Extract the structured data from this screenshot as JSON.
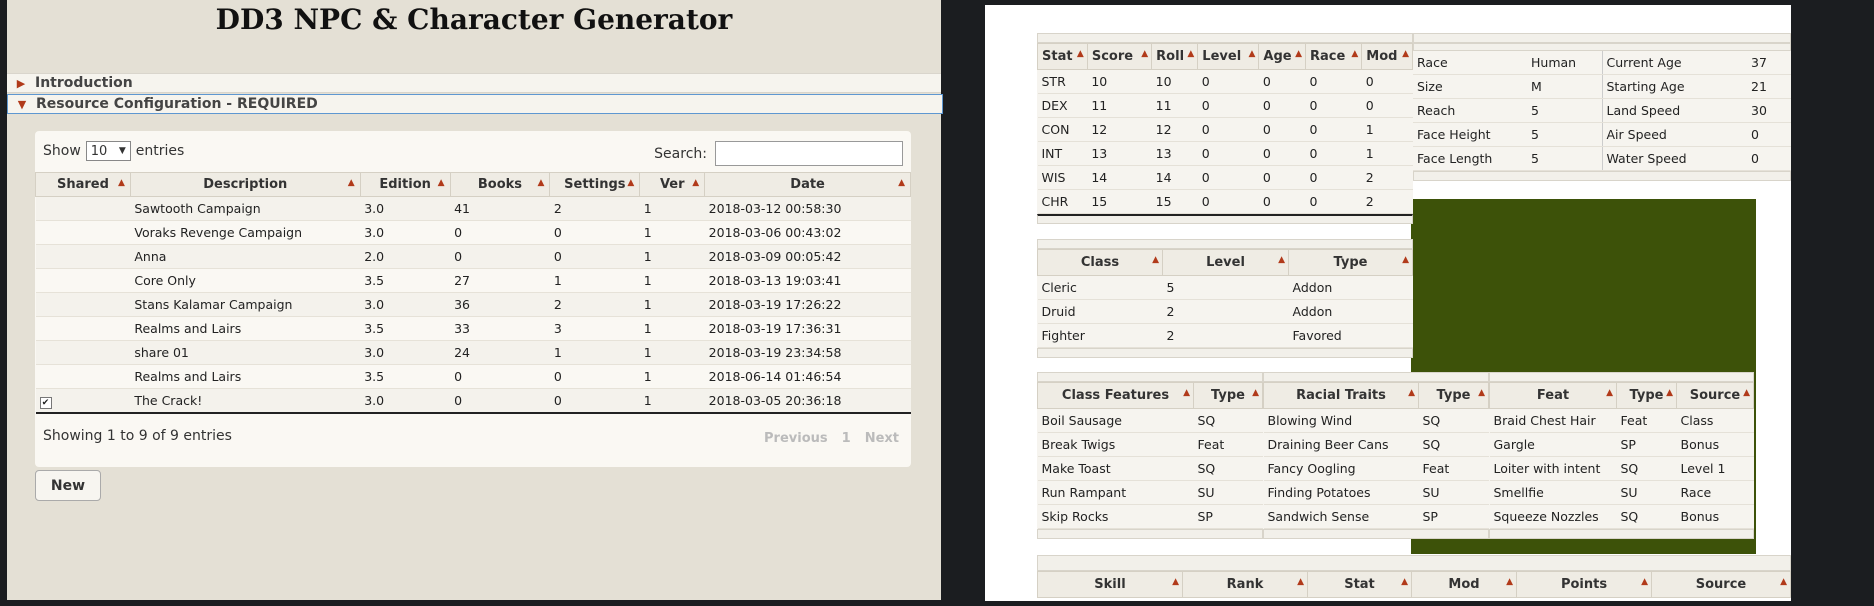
{
  "left": {
    "title": "DD3 NPC & Character Generator",
    "accordion": [
      {
        "label": "Introduction",
        "expanded": false
      },
      {
        "label": "Resource Configuration - REQUIRED",
        "expanded": true
      }
    ],
    "show_label": "Show",
    "entries_value": "10",
    "entries_label": "entries",
    "search_label": "Search:",
    "search_value": "",
    "columns": [
      "Shared",
      "Description",
      "Edition",
      "Books",
      "Settings",
      "Ver",
      "Date"
    ],
    "rows": [
      {
        "shared": false,
        "description": "Sawtooth Campaign",
        "edition": "3.0",
        "books": "41",
        "settings": "2",
        "ver": "1",
        "date": "2018-03-12 00:58:30"
      },
      {
        "shared": false,
        "description": "Voraks Revenge Campaign",
        "edition": "3.0",
        "books": "0",
        "settings": "0",
        "ver": "1",
        "date": "2018-03-06 00:43:02"
      },
      {
        "shared": false,
        "description": "Anna",
        "edition": "2.0",
        "books": "0",
        "settings": "0",
        "ver": "1",
        "date": "2018-03-09 00:05:42"
      },
      {
        "shared": false,
        "description": "Core Only",
        "edition": "3.5",
        "books": "27",
        "settings": "1",
        "ver": "1",
        "date": "2018-03-13 19:03:41"
      },
      {
        "shared": false,
        "description": "Stans Kalamar Campaign",
        "edition": "3.0",
        "books": "36",
        "settings": "2",
        "ver": "1",
        "date": "2018-03-19 17:26:22"
      },
      {
        "shared": false,
        "description": "Realms and Lairs",
        "edition": "3.5",
        "books": "33",
        "settings": "3",
        "ver": "1",
        "date": "2018-03-19 17:36:31"
      },
      {
        "shared": false,
        "description": "share 01",
        "edition": "3.0",
        "books": "24",
        "settings": "1",
        "ver": "1",
        "date": "2018-03-19 23:34:58"
      },
      {
        "shared": false,
        "description": "Realms and Lairs",
        "edition": "3.5",
        "books": "0",
        "settings": "0",
        "ver": "1",
        "date": "2018-06-14 01:46:54"
      },
      {
        "shared": true,
        "description": "The Crack!",
        "edition": "3.0",
        "books": "0",
        "settings": "0",
        "ver": "1",
        "date": "2018-03-05 20:36:18"
      }
    ],
    "showing": "Showing 1 to 9 of 9 entries",
    "pager": {
      "previous": "Previous",
      "page": "1",
      "next": "Next"
    },
    "new_button": "New"
  },
  "right": {
    "stats": {
      "columns": [
        "Stat",
        "Score",
        "Roll",
        "Level",
        "Age",
        "Race",
        "Mod"
      ],
      "rows": [
        [
          "STR",
          "10",
          "10",
          "0",
          "0",
          "0",
          "0"
        ],
        [
          "DEX",
          "11",
          "11",
          "0",
          "0",
          "0",
          "0"
        ],
        [
          "CON",
          "12",
          "12",
          "0",
          "0",
          "0",
          "1"
        ],
        [
          "INT",
          "13",
          "13",
          "0",
          "0",
          "0",
          "1"
        ],
        [
          "WIS",
          "14",
          "14",
          "0",
          "0",
          "0",
          "2"
        ],
        [
          "CHR",
          "15",
          "15",
          "0",
          "0",
          "0",
          "2"
        ]
      ]
    },
    "race_info": {
      "rows": [
        [
          "Race",
          "Human",
          "Current Age",
          "37"
        ],
        [
          "Size",
          "M",
          "Starting Age",
          "21"
        ],
        [
          "Reach",
          "5",
          "Land Speed",
          "30"
        ],
        [
          "Face Height",
          "5",
          "Air Speed",
          "0"
        ],
        [
          "Face Length",
          "5",
          "Water Speed",
          "0"
        ]
      ]
    },
    "classes": {
      "columns": [
        "Class",
        "Level",
        "Type"
      ],
      "rows": [
        [
          "Cleric",
          "5",
          "Addon"
        ],
        [
          "Druid",
          "2",
          "Addon"
        ],
        [
          "Fighter",
          "2",
          "Favored"
        ]
      ]
    },
    "class_features": {
      "columns": [
        "Class Features",
        "Type"
      ],
      "rows": [
        [
          "Boil Sausage",
          "SQ"
        ],
        [
          "Break Twigs",
          "Feat"
        ],
        [
          "Make Toast",
          "SQ"
        ],
        [
          "Run Rampant",
          "SU"
        ],
        [
          "Skip Rocks",
          "SP"
        ]
      ]
    },
    "racial_traits": {
      "columns": [
        "Racial Traits",
        "Type"
      ],
      "rows": [
        [
          "Blowing Wind",
          "SQ"
        ],
        [
          "Draining Beer Cans",
          "SQ"
        ],
        [
          "Fancy Oogling",
          "Feat"
        ],
        [
          "Finding Potatoes",
          "SU"
        ],
        [
          "Sandwich Sense",
          "SP"
        ]
      ]
    },
    "feats": {
      "columns": [
        "Feat",
        "Type",
        "Source"
      ],
      "rows": [
        [
          "Braid Chest Hair",
          "Feat",
          "Class"
        ],
        [
          "Gargle",
          "SP",
          "Bonus"
        ],
        [
          "Loiter with intent",
          "SQ",
          "Level 1"
        ],
        [
          "Smellfie",
          "SU",
          "Race"
        ],
        [
          "Squeeze Nozzles",
          "SQ",
          "Bonus"
        ]
      ]
    },
    "skills": {
      "columns": [
        "Skill",
        "Rank",
        "Stat",
        "Mod",
        "Points",
        "Source"
      ]
    }
  }
}
